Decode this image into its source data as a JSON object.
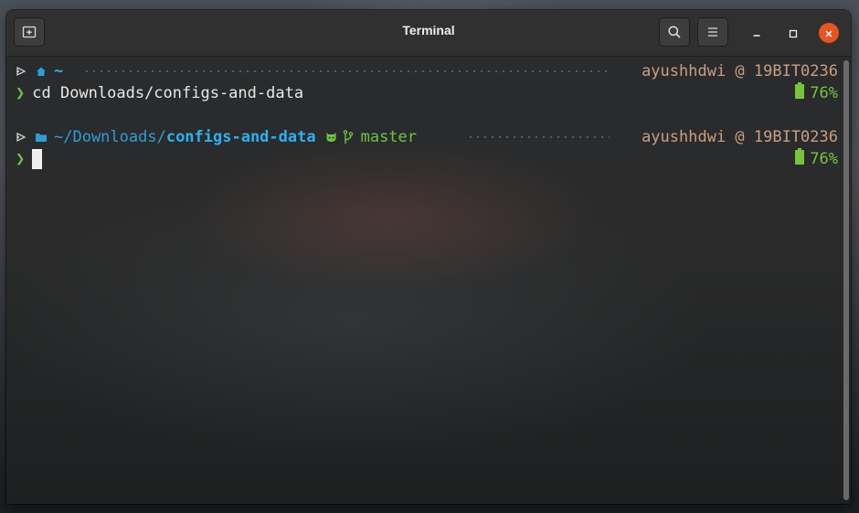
{
  "window": {
    "title": "Terminal",
    "buttons": {
      "new_tab_icon": "new-tab-icon",
      "search_icon": "search-icon",
      "menu_icon": "hamburger-menu-icon",
      "minimize_icon": "minimize-icon",
      "maximize_icon": "maximize-icon",
      "close_icon": "close-icon"
    }
  },
  "colors": {
    "accent_close": "#e95420",
    "path_cyan": "#2ab2f2",
    "prompt_green": "#6cc644",
    "host_tan": "#c8a080",
    "battery_green": "#79c43b"
  },
  "prompt1": {
    "home_icon": "home-icon",
    "path": "~",
    "user_host": "ayushhdwi @ 19BIT0236",
    "command": "cd Downloads/configs-and-data",
    "battery": "76%"
  },
  "prompt2": {
    "folder_icon": "folder-icon",
    "path_prefix": "~/Downloads/",
    "path_current": "configs-and-data",
    "git_icon": "github-icon",
    "branch_icon": "git-branch-icon",
    "branch": "master",
    "user_host": "ayushhdwi @ 19BIT0236",
    "battery": "76%"
  }
}
